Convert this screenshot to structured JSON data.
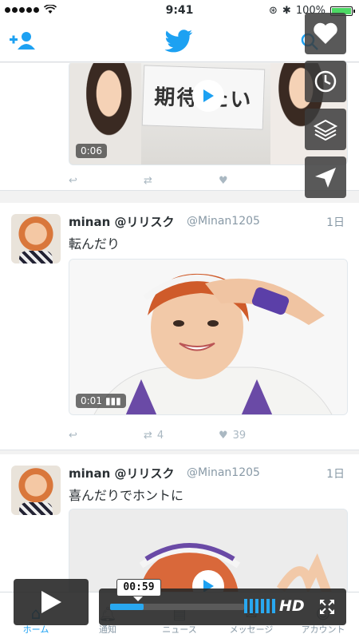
{
  "status_bar": {
    "time": "9:41",
    "battery_text": "100%",
    "battery_level": 1.0
  },
  "nav": {
    "add_user_icon": "add-user-icon",
    "logo_icon": "twitter-bird-icon",
    "search_icon": "search-icon"
  },
  "tweets": [
    {
      "video_duration": "0:06",
      "video_sign_text": "期待 たい",
      "actions": {
        "retweets": "",
        "likes": ""
      }
    },
    {
      "display_name": "minan @リリスク",
      "handle": "@Minan1205",
      "time_ago": "1日",
      "text": "転んだり",
      "video_duration": "0:01",
      "actions": {
        "retweets": "4",
        "likes": "39"
      }
    },
    {
      "display_name": "minan @リリスク",
      "handle": "@Minan1205",
      "time_ago": "1日",
      "text": "喜んだりでホントに"
    }
  ],
  "side_tools": [
    "heart-icon",
    "clock-icon",
    "layers-icon",
    "send-icon"
  ],
  "tabs": [
    {
      "label": "ホーム",
      "icon": "home-icon",
      "active": true
    },
    {
      "label": "通知",
      "icon": "bell-icon",
      "active": false
    },
    {
      "label": "ニュース",
      "icon": "news-icon",
      "active": false
    },
    {
      "label": "メッセージ",
      "icon": "mail-icon",
      "active": false
    },
    {
      "label": "アカウント",
      "icon": "person-icon",
      "active": false
    }
  ],
  "player": {
    "current_time": "00:59",
    "progress": 0.25,
    "hd_label": "HD"
  },
  "colors": {
    "twitter_blue": "#1da1f2",
    "player_accent": "#29a8f0"
  }
}
